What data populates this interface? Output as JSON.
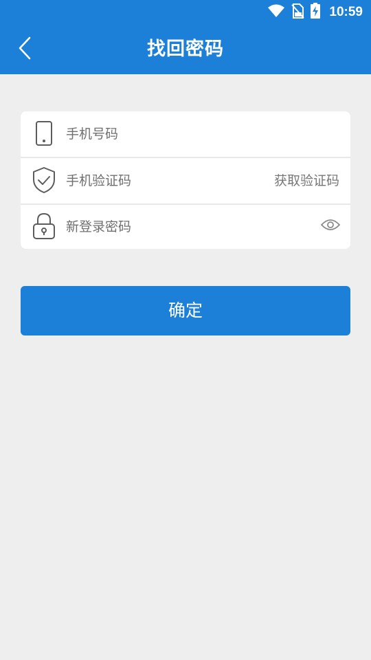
{
  "status_bar": {
    "time": "10:59",
    "icons": [
      "wifi-icon",
      "no-sim-icon",
      "battery-charging-icon"
    ]
  },
  "header": {
    "title": "找回密码",
    "back_icon": "chevron-left-icon"
  },
  "form": {
    "phone": {
      "icon": "phone-icon",
      "placeholder": "手机号码",
      "value": ""
    },
    "code": {
      "icon": "shield-check-icon",
      "placeholder": "手机验证码",
      "value": "",
      "get_code_label": "获取验证码"
    },
    "password": {
      "icon": "lock-icon",
      "placeholder": "新登录密码",
      "value": "",
      "toggle_icon": "eye-icon"
    }
  },
  "confirm_button": {
    "label": "确定"
  },
  "colors": {
    "primary": "#1c7fd8",
    "background": "#eeeeee",
    "card": "#ffffff",
    "placeholder": "#6f6f6f"
  }
}
